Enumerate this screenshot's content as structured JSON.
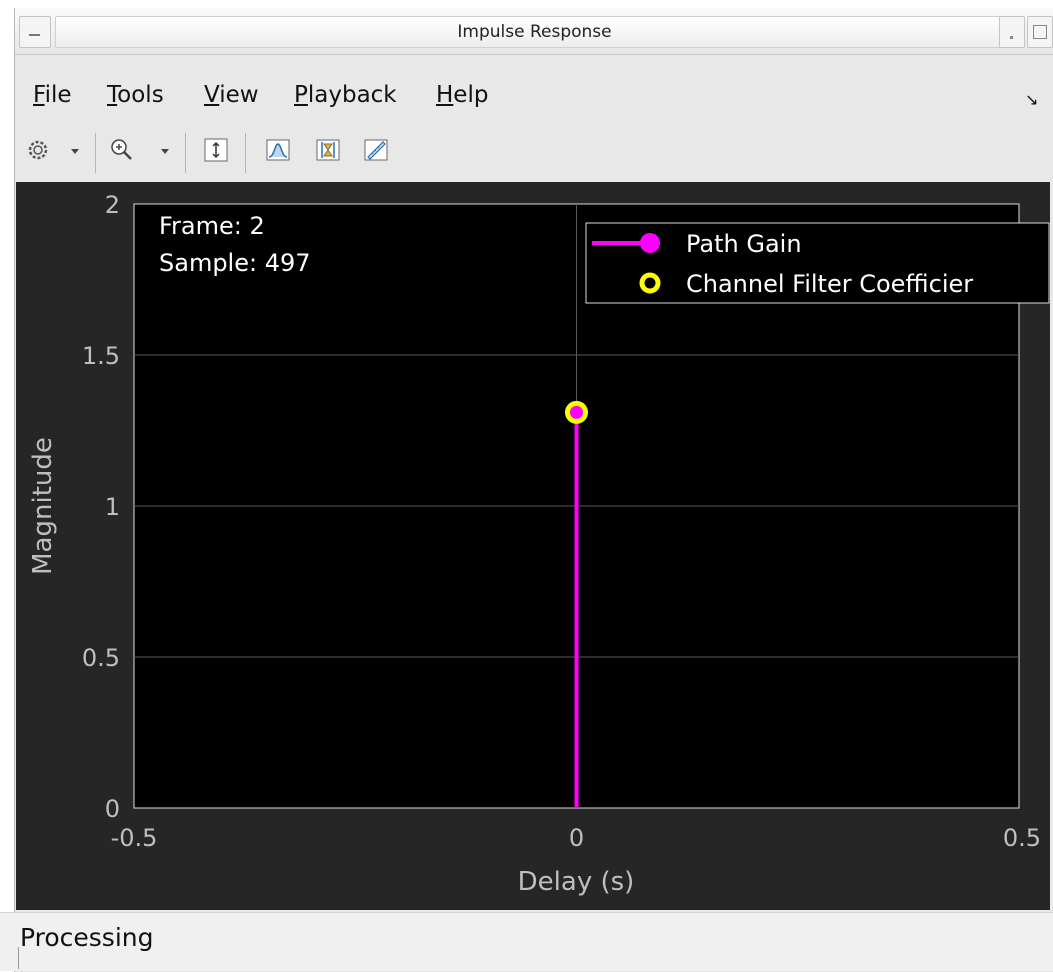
{
  "window": {
    "title": "Impulse Response"
  },
  "menu": {
    "items": [
      {
        "label": "File",
        "mnemonic": "F",
        "rest": "ile"
      },
      {
        "label": "Tools",
        "mnemonic": "T",
        "rest": "ools"
      },
      {
        "label": "View",
        "mnemonic": "V",
        "rest": "iew"
      },
      {
        "label": "Playback",
        "mnemonic": "P",
        "rest": "layback"
      },
      {
        "label": "Help",
        "mnemonic": "H",
        "rest": "elp"
      }
    ],
    "corner_icon": "dock-arrow-icon"
  },
  "toolbar": {
    "icons": [
      "gear-icon",
      "zoom-in-icon",
      "scale-axes-icon",
      "data-cursors-icon",
      "peak-finder-icon",
      "measurements-icon"
    ]
  },
  "plot": {
    "readout": {
      "frame": "Frame: 2",
      "sample": "Sample: 497"
    },
    "legend": [
      {
        "label": "Path Gain",
        "color": "#ff00ff"
      },
      {
        "label": "Channel Filter Coefficier",
        "color": "#ffff00"
      }
    ],
    "colors": {
      "background": "#000000",
      "panel": "#262626",
      "grid": "#5a5a5a",
      "axis_text": "#bfbfbf"
    }
  },
  "chart_data": {
    "type": "stem",
    "xlabel": "Delay (s)",
    "ylabel": "Magnitude",
    "xlim": [
      -0.5,
      0.5
    ],
    "ylim": [
      0,
      2
    ],
    "xticks": [
      -0.5,
      0,
      0.5
    ],
    "xtick_labels": [
      "-0.5",
      "0",
      "0.5"
    ],
    "yticks": [
      0,
      0.5,
      1,
      1.5,
      2
    ],
    "ytick_labels": [
      "0",
      "0.5",
      "1",
      "1.5",
      "2"
    ],
    "grid": true,
    "legend_position": "top-right",
    "series": [
      {
        "name": "Path Gain",
        "x": [
          0
        ],
        "y": [
          1.31
        ],
        "color": "#ff00ff"
      },
      {
        "name": "Channel Filter Coefficier",
        "x": [
          0
        ],
        "y": [
          1.31
        ],
        "color": "#ffff00"
      }
    ]
  },
  "status": {
    "text": "Processing"
  }
}
